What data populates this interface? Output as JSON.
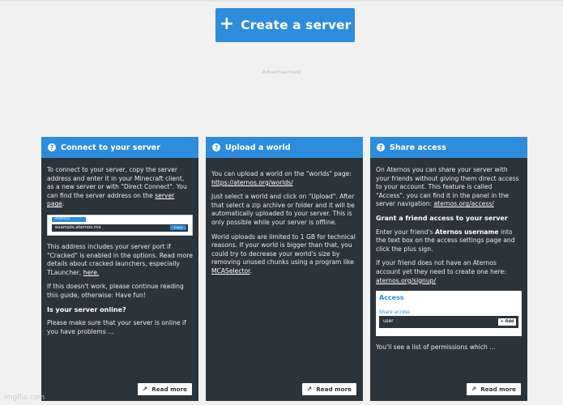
{
  "header": {
    "create_button": {
      "icon": "plus-icon",
      "plus": "+",
      "label": "Create a server"
    },
    "advertisement": "Advertisement"
  },
  "colors": {
    "accent": "#2d8cdb",
    "card_bg": "#2b333b",
    "page_bg": "#f1f1f1"
  },
  "cards": [
    {
      "title": "Connect to your server",
      "icon": "help-circle-icon",
      "p1_a": "To connect to your server, copy the server address and enter it in your Minecraft client, as a new server or with \"Direct Connect\". You can find the server address on the ",
      "p1_link": "server page",
      "p1_end": ".",
      "addr_tab": "Address",
      "addr_value": "example.aternos.me",
      "addr_copy": "Copy",
      "p2_a": "This address includes your server port if \"Cracked\" is enabled in the options. Read more details about cracked launchers, especially TLauncher, ",
      "p2_link": "here.",
      "p3": "If this doesn't work, please continue reading this guide, otherwise: Have fun!",
      "heading": "Is your server online?",
      "p4": "Please make sure that your server is online if you have problems ...",
      "read_more": "Read more"
    },
    {
      "title": "Upload a world",
      "icon": "help-circle-icon",
      "p1_a": "You can upload a world on the \"worlds\" page: ",
      "p1_link": "https://aternos.org/worlds/",
      "p2": "Just select a world and click on \"Upload\". After that select a zip archive or folder and it will be automatically uploaded to your server. This is only possible while your server is offline.",
      "p3_a": "World uploads are limited to 1 GB for technical reasons. If your world is bigger than that, you could try to decrease your world's size by removing unused chunks using a program like ",
      "p3_link": "MCASelector",
      "p3_end": ".",
      "read_more": "Read more"
    },
    {
      "title": "Share access",
      "icon": "help-circle-icon",
      "p1_a": "On Aternos you can share your server with your friends without giving them direct access to your account. This feature is called \"Access\", you can find it in the panel in the server navigation: ",
      "p1_link": "aternos.org/access/",
      "heading": "Grant a friend access to your server",
      "p2_a": "Enter your friend's ",
      "p2_bold": "Aternos username",
      "p2_b": " into the text box on the access settings page and click the plus sign.",
      "p3_a": "If your friend does not have an Aternos account yet they need to create one here: ",
      "p3_link": "aternos.org/signup/",
      "acc_title": "Access",
      "acc_sub": "Share access",
      "acc_input": "user",
      "acc_add": "+ Add",
      "p4": "You'll see a list of permissions which ...",
      "read_more": "Read more"
    }
  ],
  "watermark": "imgflip.com"
}
